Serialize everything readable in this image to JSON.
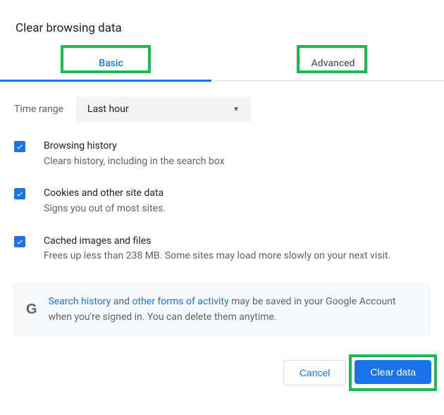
{
  "title": "Clear browsing data",
  "tabs": {
    "basic": "Basic",
    "advanced": "Advanced"
  },
  "time": {
    "label": "Time range",
    "selected": "Last hour"
  },
  "options": [
    {
      "title": "Browsing history",
      "desc": "Clears history, including in the search box",
      "checked": true
    },
    {
      "title": "Cookies and other site data",
      "desc": "Signs you out of most sites.",
      "checked": true
    },
    {
      "title": "Cached images and files",
      "desc": "Frees up less than 238 MB. Some sites may load more slowly on your next visit.",
      "checked": true
    }
  ],
  "notice": {
    "link_search": "Search history",
    "text_and": " and ",
    "link_other": "other forms of activity",
    "text_rest": " may be saved in your Google Account when you're signed in. You can delete them anytime."
  },
  "buttons": {
    "cancel": "Cancel",
    "clear": "Clear data"
  }
}
